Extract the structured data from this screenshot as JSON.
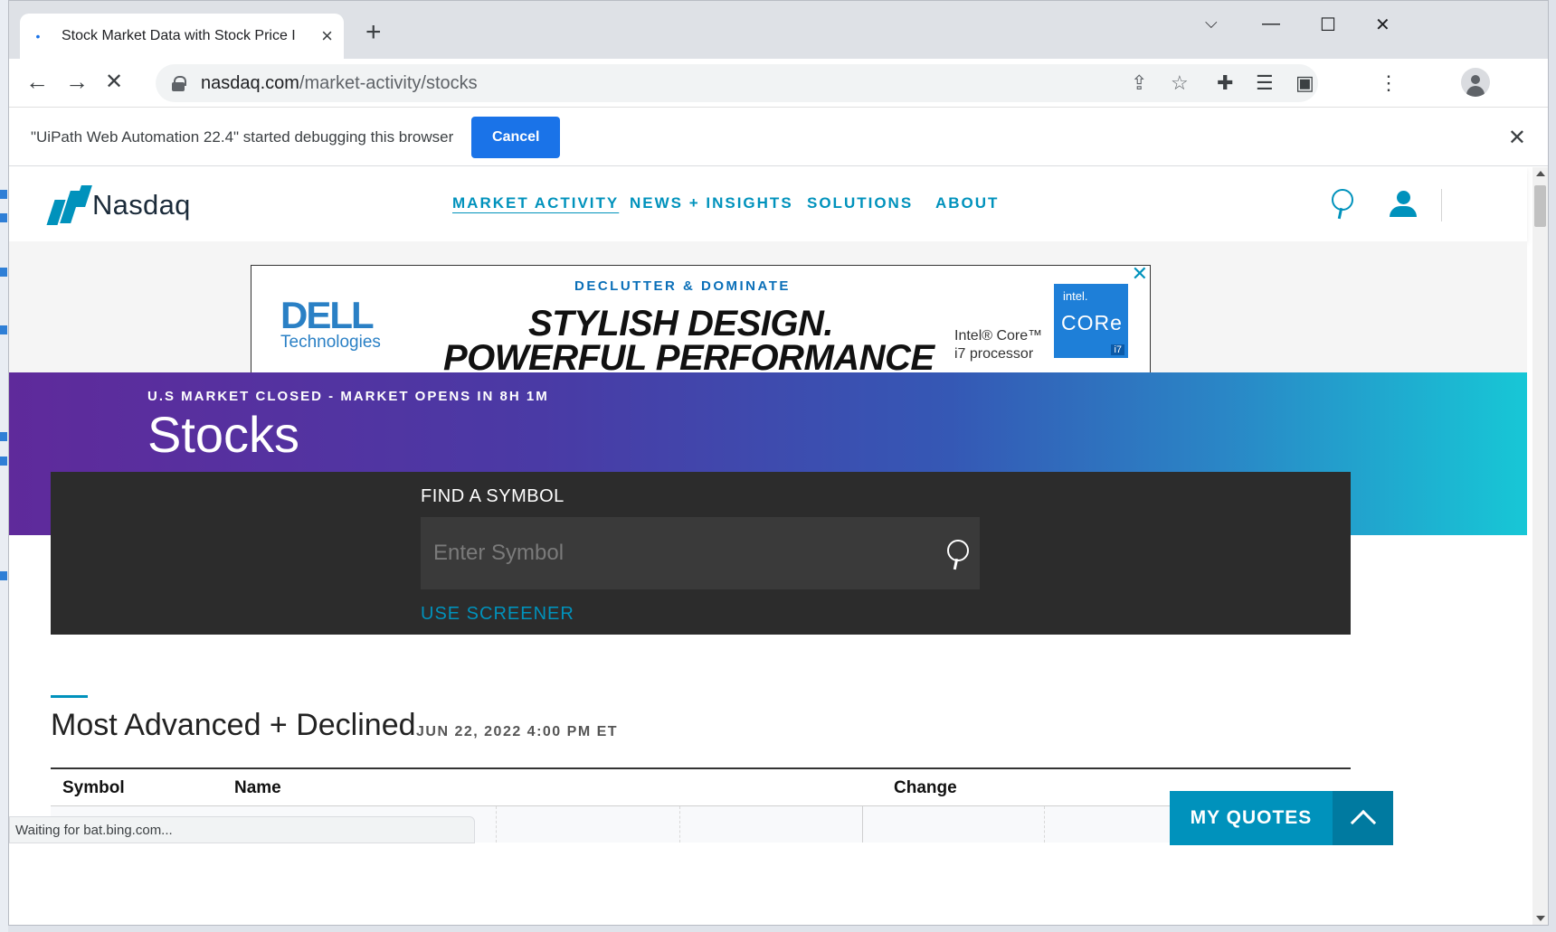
{
  "browser": {
    "tab_title": "Stock Market Data with Stock Price I",
    "url_host": "nasdaq.com",
    "url_path": "/market-activity/stocks",
    "infobar_message": "\"UiPath Web Automation 22.4\" started debugging this browser",
    "infobar_cancel": "Cancel",
    "status_text": "Waiting for bat.bing.com..."
  },
  "site": {
    "logo_text": "Nasdaq",
    "nav": [
      {
        "label": "MARKET ACTIVITY",
        "active": true
      },
      {
        "label": "NEWS + INSIGHTS",
        "active": false
      },
      {
        "label": "SOLUTIONS",
        "active": false
      },
      {
        "label": "ABOUT",
        "active": false
      }
    ],
    "accent_color": "#0092bc"
  },
  "ad": {
    "brand_line1": "DELL",
    "brand_line2": "Technologies",
    "tagline": "DECLUTTER & DOMINATE",
    "headline1": "STYLISH DESIGN.",
    "headline2": "POWERFUL PERFORMANCE",
    "processor_line1": "Intel® Core™",
    "processor_line2": "i7 processor",
    "intel_badge_top": "intel.",
    "intel_badge_mid": "CORe",
    "intel_badge_bottom": "i7"
  },
  "hero": {
    "market_status": "U.S MARKET CLOSED - MARKET OPENS IN 8H 1M",
    "title": "Stocks"
  },
  "find_symbol": {
    "label": "FIND A SYMBOL",
    "placeholder": "Enter Symbol",
    "screener_link": "USE SCREENER"
  },
  "section": {
    "title": "Most Advanced + Declined",
    "date": "JUN 22, 2022 4:00 PM ET",
    "columns": [
      "Symbol",
      "Name",
      "Change"
    ]
  },
  "my_quotes": {
    "label": "MY QUOTES"
  }
}
